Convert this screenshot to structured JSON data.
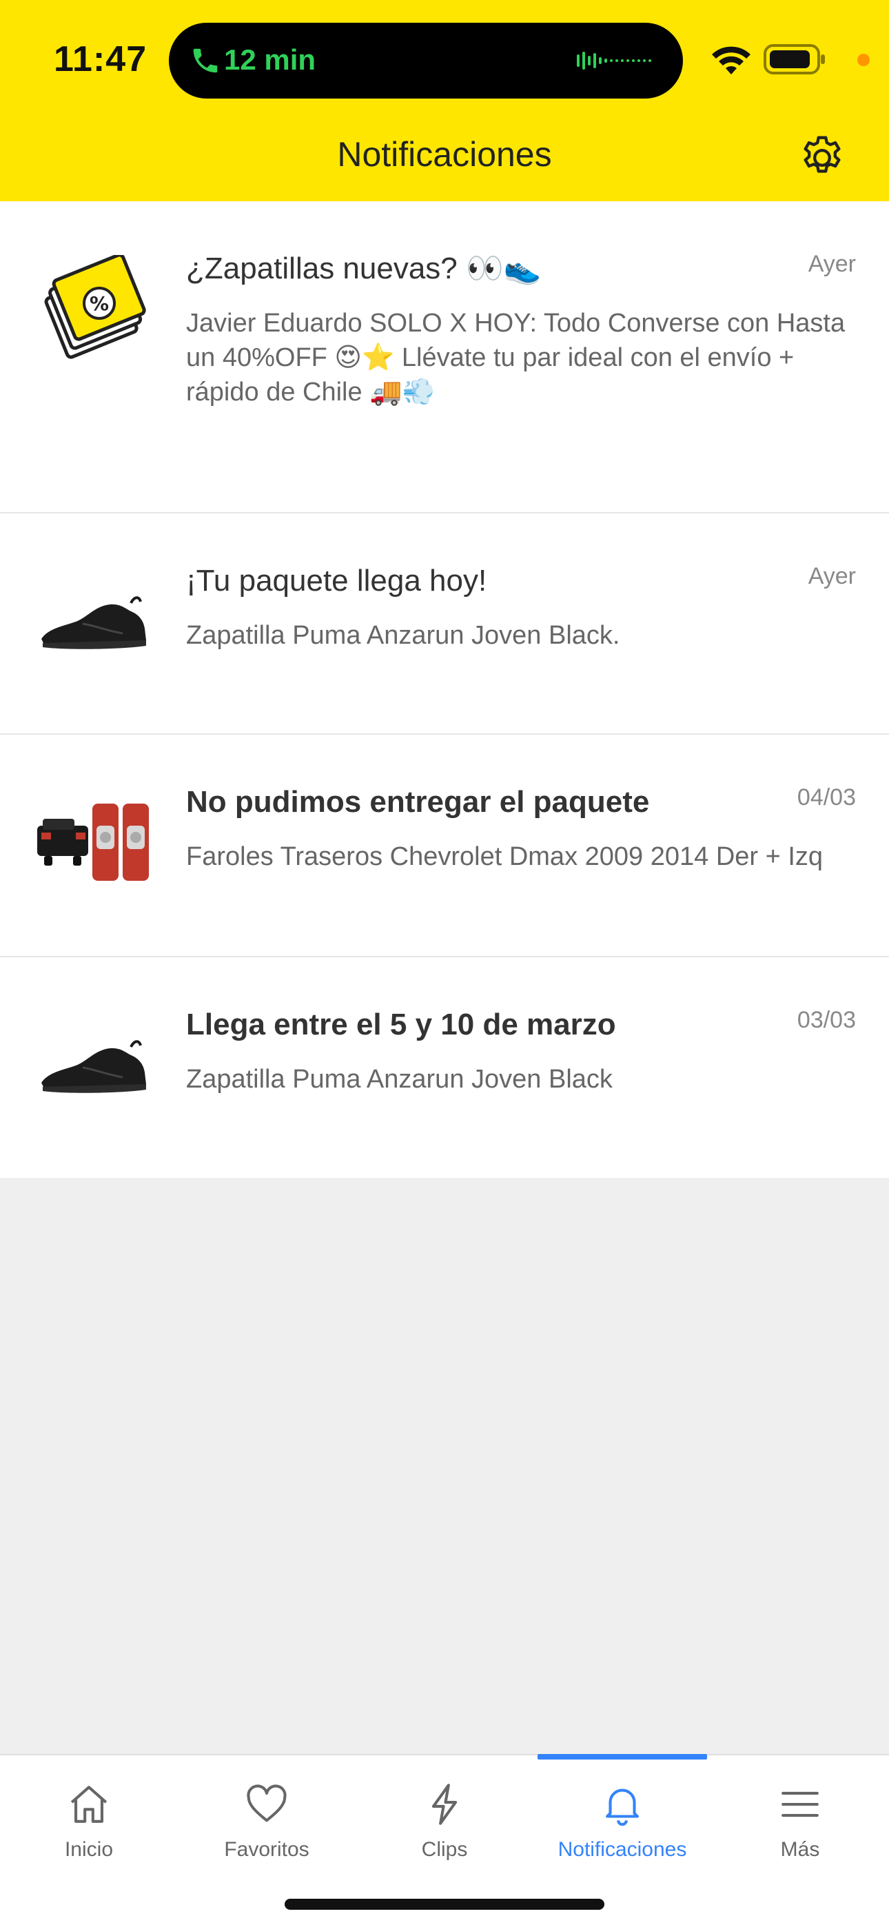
{
  "status_bar": {
    "time": "11:47",
    "call_timer": "12 min",
    "icons": [
      "phone-icon",
      "audio-waveform-icon",
      "wifi-icon",
      "battery-icon"
    ]
  },
  "header": {
    "title": "Notificaciones",
    "background_color": "#ffe600",
    "settings_icon": "gear-icon"
  },
  "notifications": [
    {
      "thumbnail": "discount-tag-icon",
      "title": "¿Zapatillas nuevas? 👀👟",
      "date": "Ayer",
      "body": "Javier Eduardo SOLO X HOY: Todo Converse con Hasta un 40%OFF 😍⭐ Llévate tu par ideal con el envío + rápido de Chile 🚚💨",
      "bold": false
    },
    {
      "thumbnail": "black-sneaker-image",
      "title": "¡Tu paquete llega hoy!",
      "date": "Ayer",
      "body": "Zapatilla Puma Anzarun Joven Black.",
      "bold": false
    },
    {
      "thumbnail": "pickup-tail-lights-image",
      "title": "No pudimos entregar el paquete",
      "date": "04/03",
      "body": "Faroles Traseros Chevrolet Dmax 2009  2014 Der + Izq",
      "bold": true
    },
    {
      "thumbnail": "black-sneaker-image",
      "title": "Llega entre el 5 y 10 de marzo",
      "date": "03/03",
      "body": "Zapatilla Puma Anzarun Joven Black",
      "bold": true
    }
  ],
  "bottom_nav": {
    "active_color": "#3483fa",
    "items": [
      {
        "label": "Inicio",
        "icon": "home-icon",
        "active": false
      },
      {
        "label": "Favoritos",
        "icon": "heart-icon",
        "active": false
      },
      {
        "label": "Clips",
        "icon": "lightning-icon",
        "active": false
      },
      {
        "label": "Notificaciones",
        "icon": "bell-icon",
        "active": true
      },
      {
        "label": "Más",
        "icon": "menu-icon",
        "active": false
      }
    ]
  }
}
